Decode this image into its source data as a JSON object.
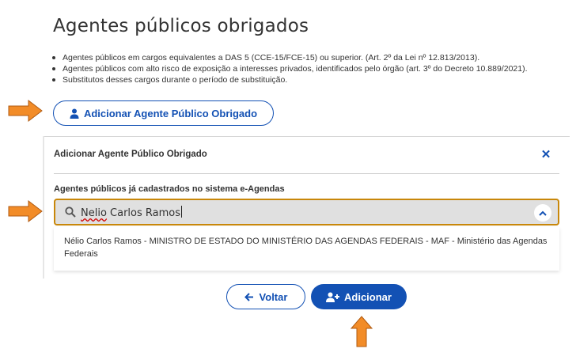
{
  "page": {
    "title": "Agentes públicos obrigados",
    "bullets": [
      "Agentes públicos em cargos equivalentes a DAS 5 (CCE-15/FCE-15) ou superior. (Art. 2º da Lei nº 12.813/2013).",
      "Agentes públicos com alto risco de exposição a interesses privados, identificados pelo órgão (art. 3º do Decreto 10.889/2021).",
      "Substitutos desses cargos durante o período de substituição."
    ],
    "open_button_label": "Adicionar Agente Público Obrigado"
  },
  "modal": {
    "title": "Adicionar Agente Público Obrigado",
    "close_icon": "close-icon",
    "field_label": "Agentes públicos já cadastrados no sistema e-Agendas",
    "search": {
      "value_first": "Nelio",
      "value_rest": " Carlos Ramos",
      "icon": "search-icon"
    },
    "results": [
      "Nélio Carlos Ramos - MINISTRO DE ESTADO DO MINISTÉRIO DAS AGENDAS FEDERAIS - MAF - Ministério das Agendas Federais"
    ],
    "back_label": "Voltar",
    "add_label": "Adicionar"
  },
  "colors": {
    "primary": "#1351b4",
    "highlight_border": "#c8870a",
    "annotation_arrow": "#f28c28"
  }
}
